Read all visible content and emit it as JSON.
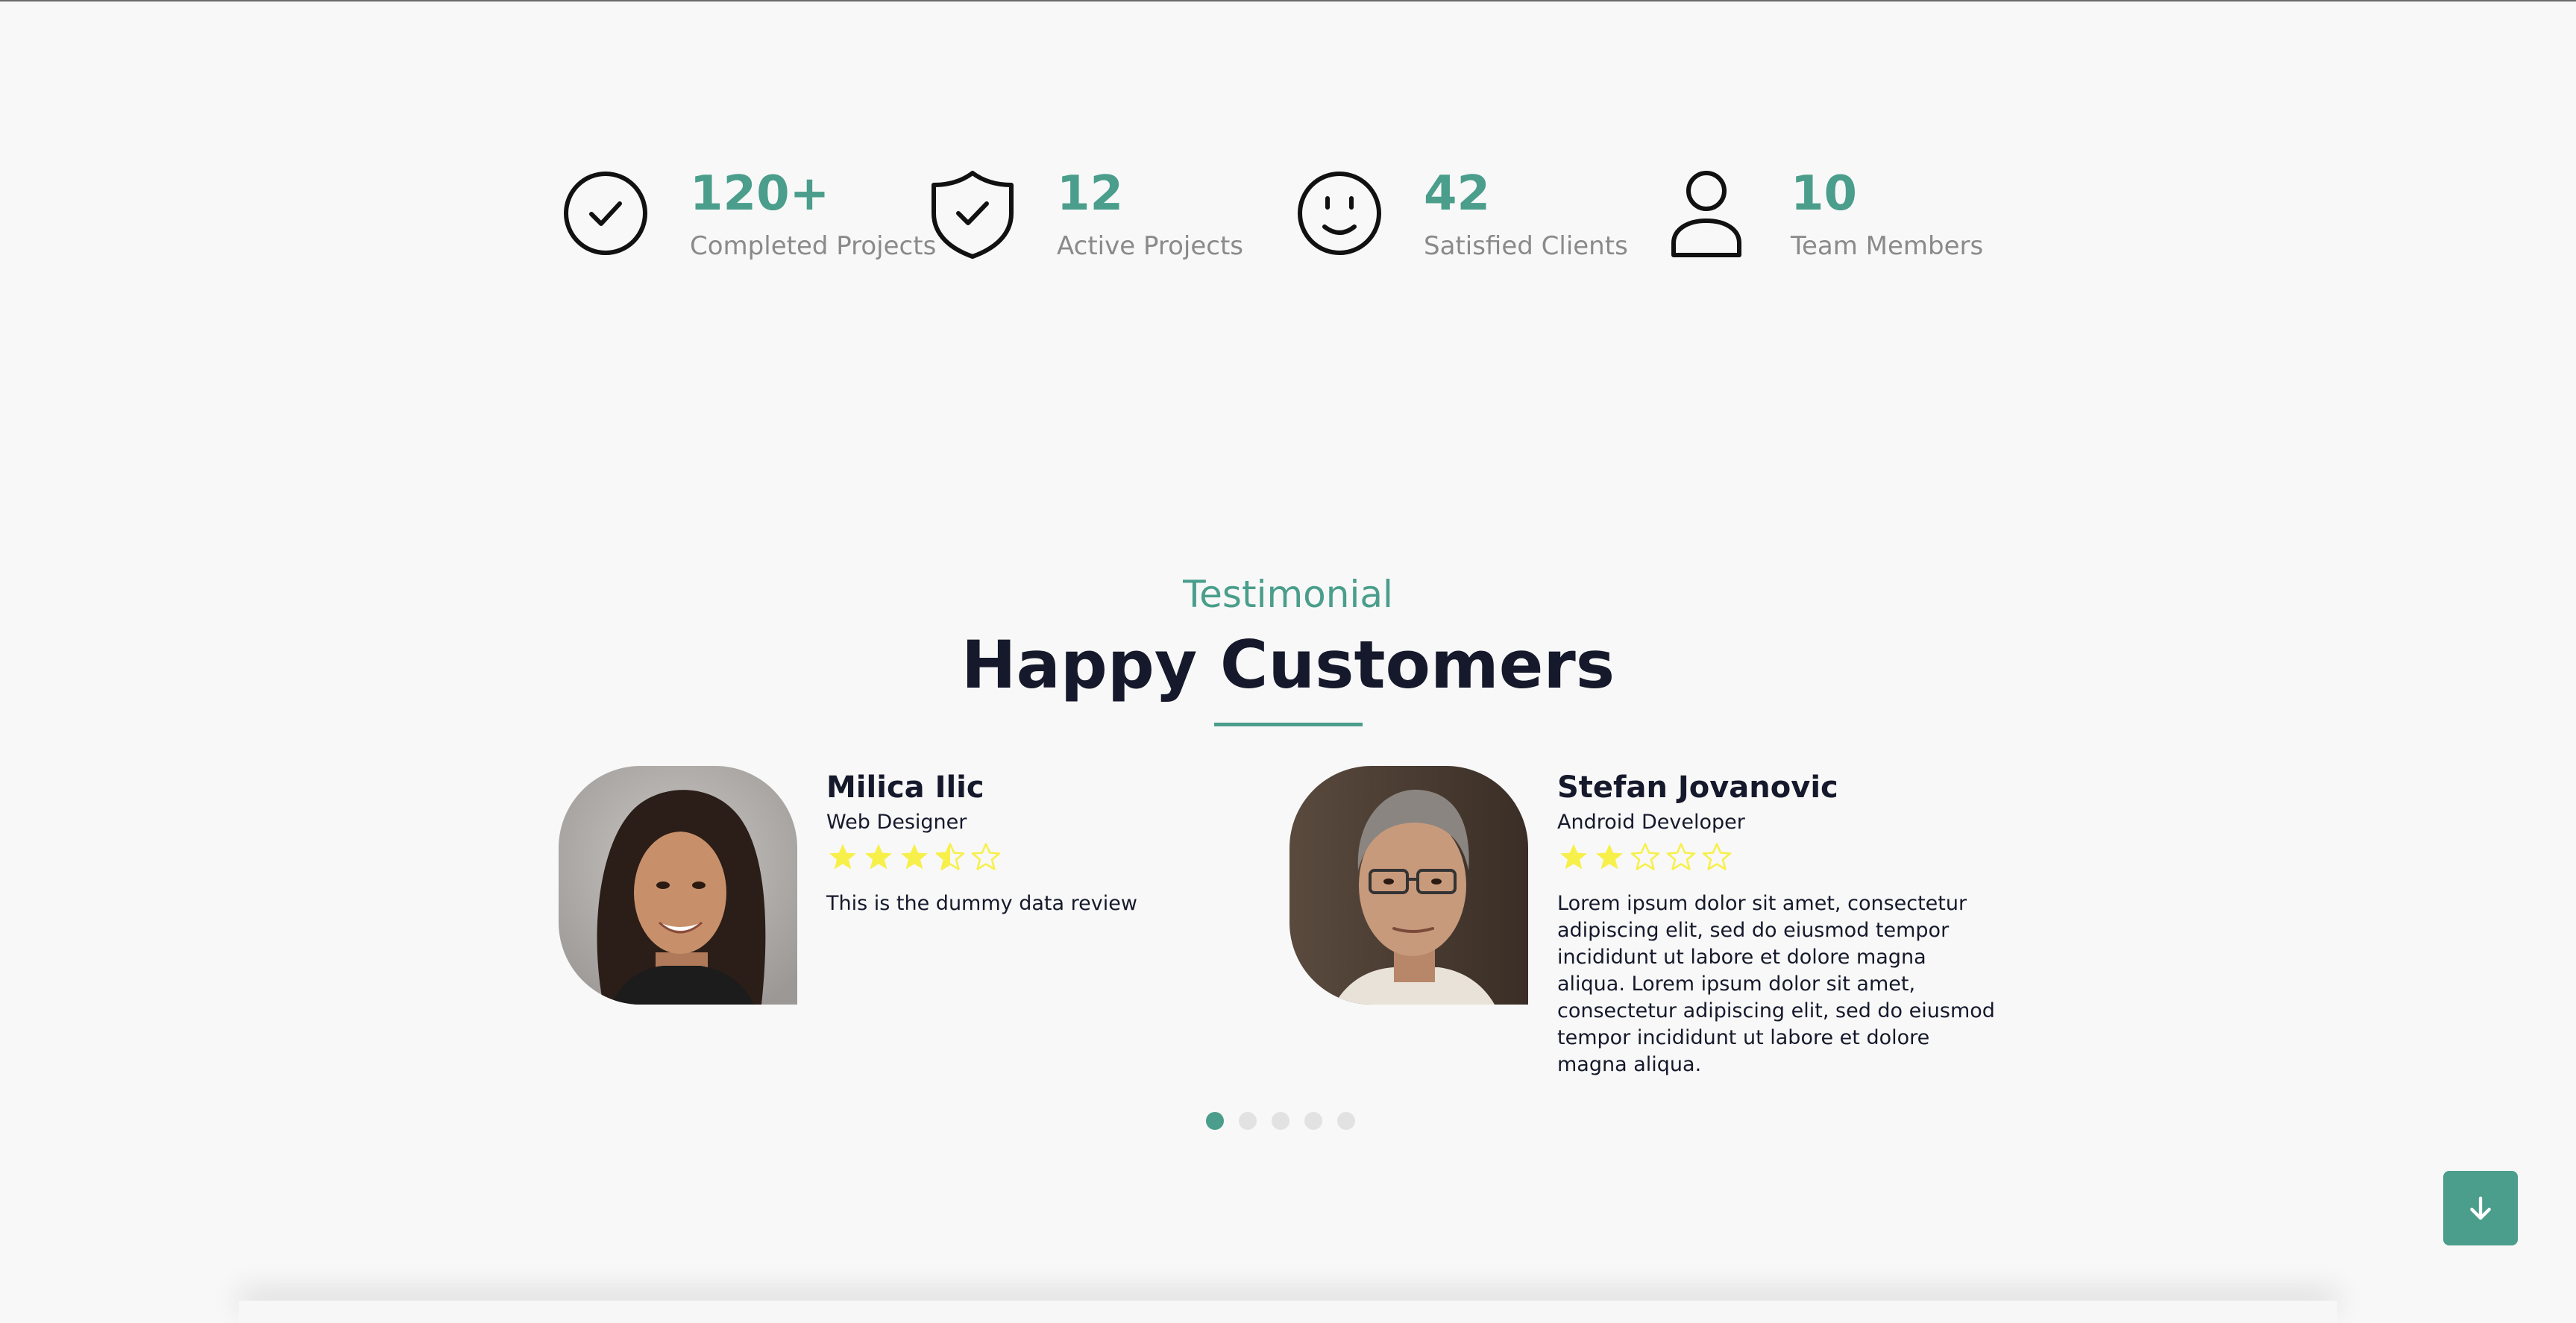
{
  "stats": [
    {
      "value": "120+",
      "label": "Completed Projects",
      "icon": "check-circle-icon"
    },
    {
      "value": "12",
      "label": "Active Projects",
      "icon": "shield-check-icon"
    },
    {
      "value": "42",
      "label": "Satisfied Clients",
      "icon": "smile-icon"
    },
    {
      "value": "10",
      "label": "Team Members",
      "icon": "user-icon"
    }
  ],
  "testimonial": {
    "eyebrow": "Testimonial",
    "heading": "Happy Customers",
    "cards": [
      {
        "name": "Milica Ilic",
        "role": "Web Designer",
        "rating": 3.5,
        "review": "This is the dummy data review"
      },
      {
        "name": "Stefan Jovanovic",
        "role": "Android Developer",
        "rating": 2,
        "review": "Lorem ipsum dolor sit amet, consectetur adipiscing elit, sed do eiusmod tempor incididunt ut labore et dolore magna aliqua. Lorem ipsum dolor sit amet, consectetur adipiscing elit, sed do eiusmod tempor incididunt ut labore et dolore magna aliqua."
      }
    ],
    "pagination": {
      "total": 5,
      "active": 1
    }
  },
  "scroll_button": {
    "icon": "arrow-down-icon"
  },
  "colors": {
    "accent": "#4a9e8b",
    "heading": "#15192b",
    "muted": "#8a8a8a",
    "star": "#f7f04a",
    "background": "#f8f8f8"
  }
}
